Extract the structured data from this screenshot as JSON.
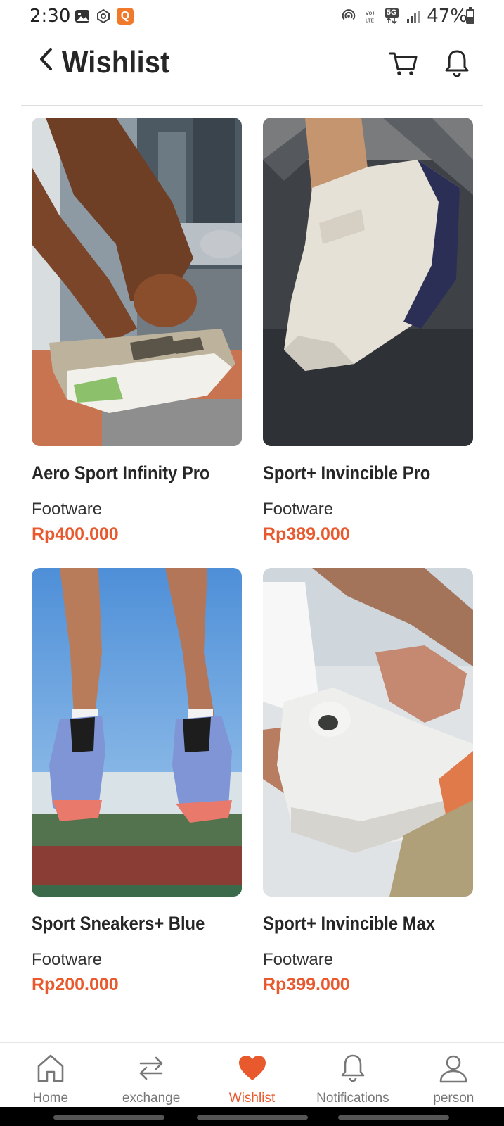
{
  "status_bar": {
    "time": "2:30",
    "q_badge": "Q",
    "network_label": "5G",
    "battery_percent": "47%",
    "battery_level": 0.47,
    "icons": [
      "gallery-icon",
      "sync-icon",
      "q-app-icon",
      "hotspot-icon",
      "volte-icon",
      "5g-icon",
      "signal-icon",
      "battery-icon"
    ]
  },
  "header": {
    "title": "Wishlist",
    "icons": [
      "back-chevron-icon",
      "cart-icon",
      "bell-icon"
    ]
  },
  "colors": {
    "accent": "#e8592e",
    "text_dark": "#262626",
    "nav_inactive": "#777777",
    "divider": "#dedede"
  },
  "products": [
    {
      "name": "Aero Sport Infinity Pro",
      "category": "Footware",
      "price": "Rp400.000",
      "image": "sneaker-lacing-city-photo"
    },
    {
      "name": "Sport+ Invincible Pro",
      "category": "Footware",
      "price": "Rp389.000",
      "image": "white-running-shoe-photo"
    },
    {
      "name": "Sport Sneakers+ Blue",
      "category": "Footware",
      "price": "Rp200.000",
      "image": "blue-sneakers-jump-photo"
    },
    {
      "name": "Sport+ Invincible Max",
      "category": "Footware",
      "price": "Rp399.000",
      "image": "white-sneaker-tying-photo"
    }
  ],
  "bottom_nav": {
    "items": [
      {
        "label": "Home",
        "icon": "home-icon"
      },
      {
        "label": "exchange",
        "icon": "exchange-icon"
      },
      {
        "label": "Wishlist",
        "icon": "heart-icon",
        "active": true
      },
      {
        "label": "Notifications",
        "icon": "bell-icon"
      },
      {
        "label": "person",
        "icon": "person-icon"
      }
    ]
  }
}
